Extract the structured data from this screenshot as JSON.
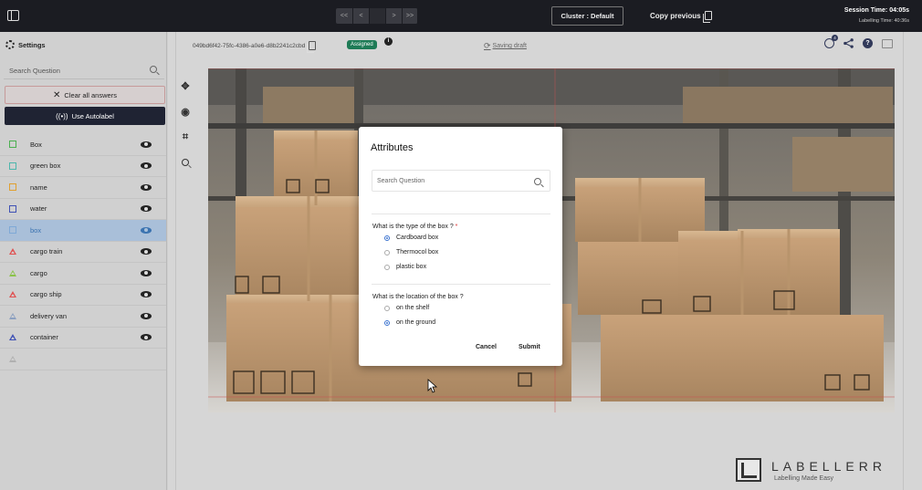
{
  "topbar": {
    "nav_buttons": [
      "<<",
      "<",
      "",
      ">",
      ">>"
    ],
    "cluster_label": "Cluster : Default",
    "copy_previous_label": "Copy previous",
    "session_time": "Session Time: 04:05s",
    "labelling_time": "Labelling Time: 40:36s"
  },
  "sidebar": {
    "settings_label": "Settings",
    "search_placeholder": "Search Question",
    "clear_label": "Clear all answers",
    "autolabel_label": "Use Autolabel",
    "classes": [
      {
        "name": "Box",
        "shape": "box",
        "color": "#4caf50"
      },
      {
        "name": "green box",
        "shape": "box",
        "color": "#4db6ac"
      },
      {
        "name": "name",
        "shape": "box",
        "color": "#e0a030"
      },
      {
        "name": "water",
        "shape": "box",
        "color": "#3f51b5"
      },
      {
        "name": "box",
        "shape": "box",
        "color": "#7fa9d6"
      },
      {
        "name": "cargo train",
        "shape": "triangle",
        "color": "#e05050"
      },
      {
        "name": "cargo",
        "shape": "triangle",
        "color": "#8bc34a"
      },
      {
        "name": "cargo ship",
        "shape": "triangle",
        "color": "#e05050"
      },
      {
        "name": "delivery van",
        "shape": "triangle",
        "color": "#8ca0c0"
      },
      {
        "name": "container",
        "shape": "triangle",
        "color": "#3f51b5"
      },
      {
        "name": "",
        "shape": "triangle",
        "color": "#b0b0b0"
      }
    ]
  },
  "header": {
    "task_id": "049bd6f42-75fc-4386-a0e6-d8b2241c2cbd",
    "status_badge": "Assigned",
    "info": "i",
    "saving_label": "Saving draft",
    "history_count": "4",
    "help": "?"
  },
  "modal": {
    "title": "Attributes",
    "search_placeholder": "Search Question",
    "q1_label": "What is the type of the box ?",
    "q1_required": "*",
    "q1_options": [
      "Cardboard box",
      "Thermocol box",
      "plastic box"
    ],
    "q1_selected": 0,
    "q2_label": "What is the location of the box ?",
    "q2_options": [
      "on the shelf",
      "on the ground"
    ],
    "q2_selected": 1,
    "cancel_label": "Cancel",
    "submit_label": "Submit"
  },
  "watermark": {
    "brand": "LABELLERR",
    "tagline": "Labelling Made Easy"
  },
  "colors": {
    "topbar": "#1b1c22",
    "assigned": "#1e7b56",
    "selected_row": "#a9bfd9",
    "autolabel_btn": "#1f2333"
  }
}
